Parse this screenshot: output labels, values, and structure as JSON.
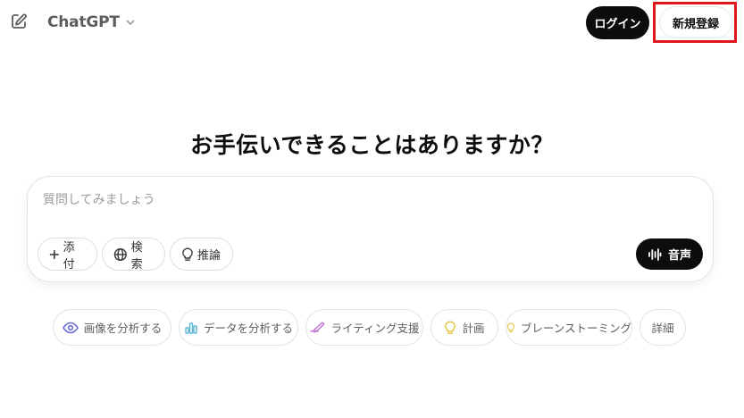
{
  "header": {
    "model_name": "ChatGPT",
    "login_label": "ログイン",
    "signup_label": "新規登録"
  },
  "main": {
    "headline": "お手伝いできることはありますか？"
  },
  "composer": {
    "placeholder": "質問してみましょう",
    "value": "",
    "tools": [
      {
        "label": "添付",
        "icon": "plus-icon"
      },
      {
        "label": "検索",
        "icon": "globe-icon"
      },
      {
        "label": "推論",
        "icon": "lightbulb-icon"
      }
    ],
    "voice_label": "音声"
  },
  "suggestions": [
    {
      "label": "画像を分析する",
      "icon": "eye-icon",
      "color": "#6b6fd6"
    },
    {
      "label": "データを分析する",
      "icon": "bar-chart-icon",
      "color": "#5ab7d6"
    },
    {
      "label": "ライティング支援",
      "icon": "pen-icon",
      "color": "#c277d6"
    },
    {
      "label": "計画",
      "icon": "lightbulb-icon",
      "color": "#e2c541"
    },
    {
      "label": "ブレーンストーミング",
      "icon": "lightbulb-icon",
      "color": "#e2c541"
    },
    {
      "label": "詳細"
    }
  ],
  "colors": {
    "accent_dark": "#0d0d0d",
    "highlight_box": "#e0151e"
  }
}
